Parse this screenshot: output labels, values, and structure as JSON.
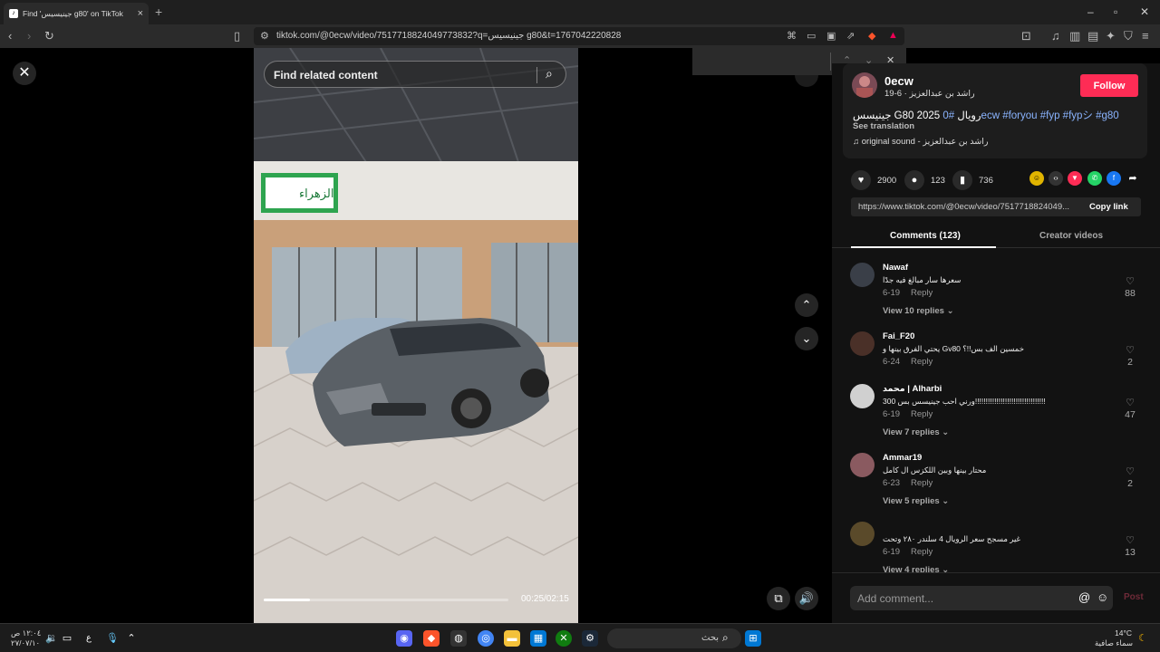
{
  "browser": {
    "tab_title": "Find 'جينيسيس g80' on TikTok",
    "url": "tiktok.com/@0ecw/video/7517718824049773832?q=جينيسيس g80&t=1767042220828"
  },
  "video": {
    "search_placeholder": "Find related content",
    "time": "00:25/02:15",
    "progress_fraction": 0.19,
    "sign_text": "الزهراء"
  },
  "post": {
    "username": "0ecw",
    "subline": "راشد بن عبدالعزيز · 6-19",
    "follow_label": "Follow",
    "caption_text": "جينيسس G80 2025 رويال ",
    "caption_tags": "#0ecw #foryou #fyp #fypシ #g80",
    "see_translation": "See translation",
    "music": "original sound - راشد بن عبدالعزيز",
    "likes": "2900",
    "comments": "123",
    "saves": "736",
    "link": "https://www.tiktok.com/@0ecw/video/7517718824049...",
    "copy_link": "Copy link"
  },
  "tabs": {
    "comments": "Comments (123)",
    "creator": "Creator videos"
  },
  "comments": [
    {
      "name": "Nawaf",
      "text": "سعرها سار مبالغ فيه جدًا",
      "date": "6-19",
      "reply": "Reply",
      "likes": "88",
      "replies": "View 10 replies ⌄",
      "avatar": "#3a3f48"
    },
    {
      "name": "Fai_F20",
      "text": "يحتي الفرق بينها و Gv80 خمسين الف بس!!؟",
      "date": "6-24",
      "reply": "Reply",
      "likes": "2",
      "replies": "",
      "avatar": "#4a3028"
    },
    {
      "name": "محمد | Alharbi",
      "text": "ورني احب جينيسس بس 300!!!!!!!!!!!!!!!!!!!!!!!!!!!!!!!!!",
      "date": "6-19",
      "reply": "Reply",
      "likes": "47",
      "replies": "View 7 replies ⌄",
      "avatar": "#d0d0d0"
    },
    {
      "name": "Ammar19",
      "text": "محتار بينها وبين اللكزس ال كامل",
      "date": "6-23",
      "reply": "Reply",
      "likes": "2",
      "replies": "View 5 replies ⌄",
      "avatar": "#8a5a60"
    },
    {
      "name": "",
      "text": "غير مسجح سعر الرويال 4 سلندر ٢٨٠ وتحت",
      "date": "6-19",
      "reply": "Reply",
      "likes": "13",
      "replies": "View 4 replies ⌄",
      "avatar": "#5a4a2a"
    }
  ],
  "comment_box": {
    "placeholder": "Add comment...",
    "post": "Post"
  },
  "taskbar": {
    "search_label": "بحث",
    "time": "١٢:٠٤ ص",
    "date": "٢٧/٠٧/١٠",
    "lang": "ع",
    "weather_temp": "14°C",
    "weather_text": "سماء صافية"
  },
  "colors": {
    "accent": "#fe2c55",
    "tag": "#8ab4ff"
  },
  "icons": {
    "close": "close-icon",
    "search": "search-icon",
    "like": "heart-icon",
    "comment": "comment-icon",
    "save": "bookmark-icon"
  }
}
